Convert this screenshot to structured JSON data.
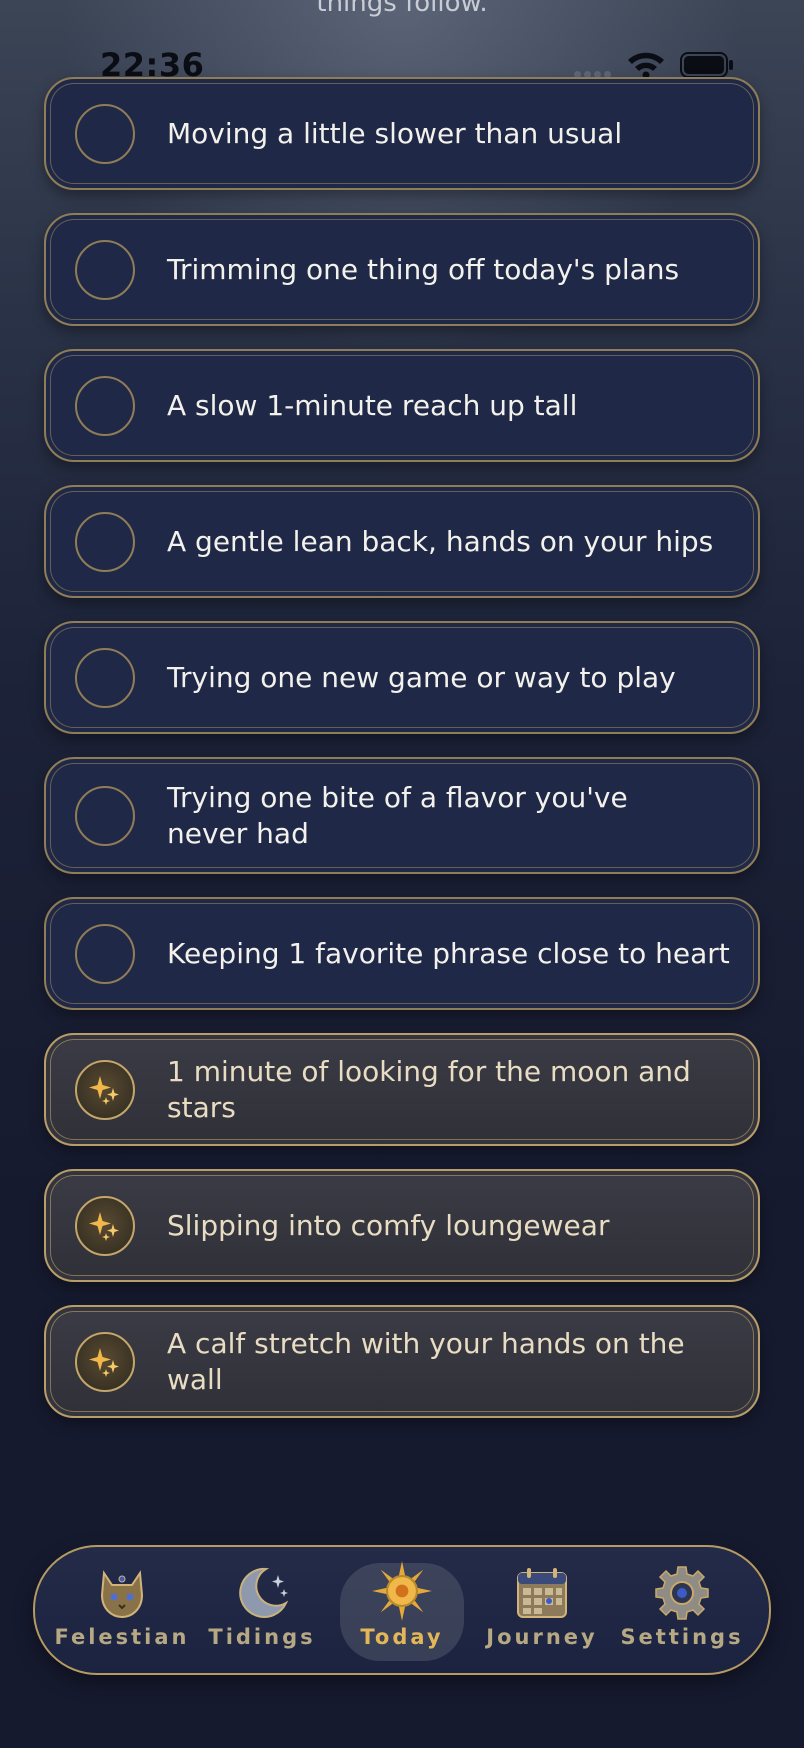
{
  "header": {
    "partial_text": "things follow."
  },
  "status_bar": {
    "time": "22:36"
  },
  "tasks": [
    {
      "label": "Moving a little slower than usual",
      "completed": false
    },
    {
      "label": "Trimming one thing off today's plans",
      "completed": false
    },
    {
      "label": "A slow 1-minute reach up tall",
      "completed": false
    },
    {
      "label": "A gentle lean back, hands on your hips",
      "completed": false
    },
    {
      "label": "Trying one new game or way to play",
      "completed": false
    },
    {
      "label": "Trying one bite of a flavor you've never had",
      "completed": false
    },
    {
      "label": "Keeping 1 favorite phrase close to heart",
      "completed": false
    },
    {
      "label": "1 minute of looking for the moon and stars",
      "completed": true
    },
    {
      "label": "Slipping into comfy loungewear",
      "completed": true
    },
    {
      "label": "A calf stretch with your hands on the wall",
      "completed": true
    }
  ],
  "tabbar": {
    "tabs": [
      {
        "label": "Felestian",
        "icon": "cat-crest-icon",
        "active": false
      },
      {
        "label": "Tidings",
        "icon": "crescent-moon-icon",
        "active": false
      },
      {
        "label": "Today",
        "icon": "sun-icon",
        "active": true
      },
      {
        "label": "Journey",
        "icon": "calendar-icon",
        "active": false
      },
      {
        "label": "Settings",
        "icon": "gear-icon",
        "active": false
      }
    ]
  },
  "colors": {
    "gold": "#b59a62",
    "active_tab": "#e3b758",
    "card_bg": "#1f2846",
    "card_done_bg": "#35363f"
  }
}
